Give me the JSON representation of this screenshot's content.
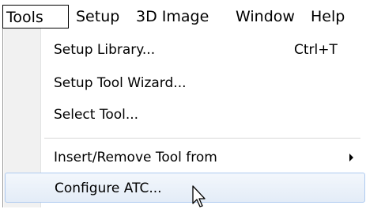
{
  "menubar": {
    "items": [
      {
        "label": "Tools"
      },
      {
        "label": "Setup"
      },
      {
        "label": "3D Image"
      },
      {
        "label": "Window"
      },
      {
        "label": "Help"
      }
    ]
  },
  "tools_menu": {
    "items": [
      {
        "label": "Setup Library...",
        "shortcut": "Ctrl+T"
      },
      {
        "label": "Setup Tool Wizard..."
      },
      {
        "label": "Select Tool..."
      },
      {
        "label": "Insert/Remove Tool from",
        "submenu": true
      },
      {
        "label": "Configure ATC...",
        "hovered": true
      }
    ]
  },
  "colors": {
    "hover_border": "#aecaf0",
    "hover_fill": "#e3ecf7",
    "icon_strip": "#f1f1f1"
  },
  "icons": {
    "submenu": "chevron-right-icon",
    "pointer": "mouse-pointer-icon"
  }
}
